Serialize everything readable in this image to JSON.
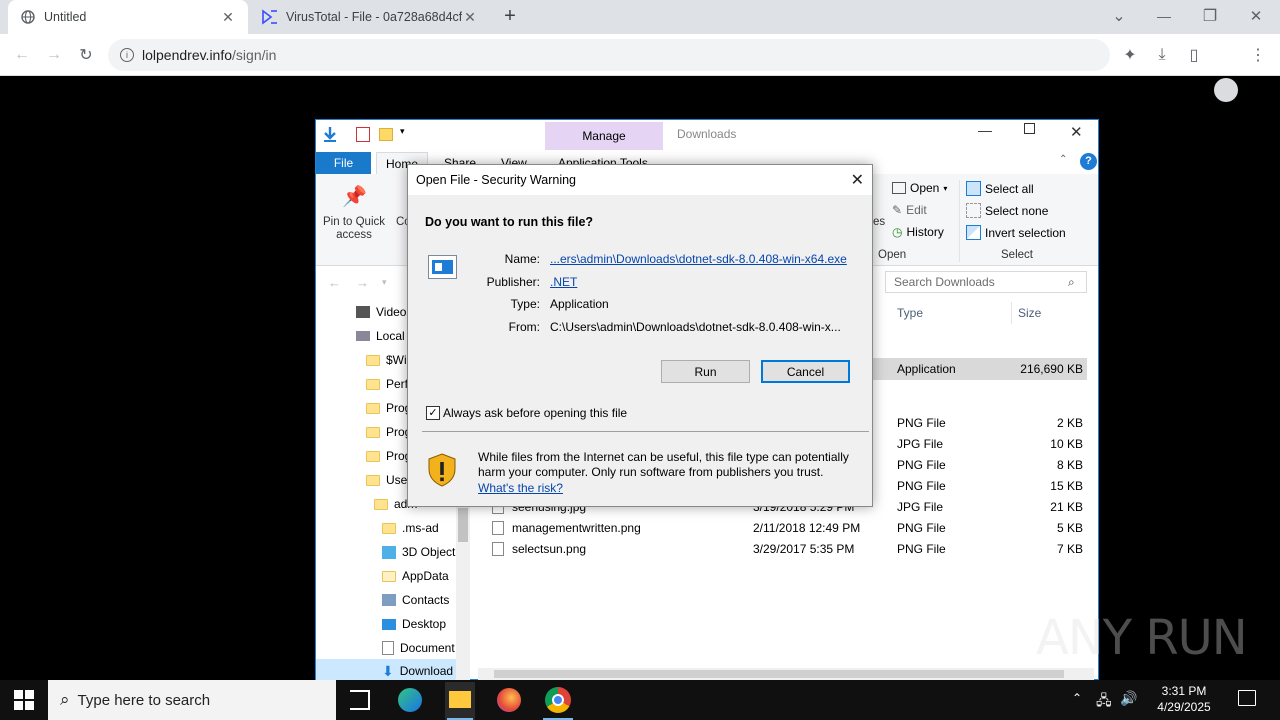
{
  "browser": {
    "tabs": [
      {
        "title": "Untitled",
        "close": "✕"
      },
      {
        "title": "VirusTotal - File - 0a728a68d4cf7…",
        "close": "✕"
      }
    ],
    "new_tab": "+",
    "url_host": "lolpendrev.info",
    "url_path": "/sign/in"
  },
  "explorer": {
    "manage_tab": "Manage",
    "window_title": "Downloads",
    "ribbon_tabs": [
      "File",
      "Home",
      "Share",
      "View",
      "Application Tools"
    ],
    "pin_label": "Pin to Quick access",
    "copy_label": "Co",
    "partial_label": "es",
    "open_group": {
      "open": "Open",
      "edit": "Edit",
      "history": "History",
      "label": "Open"
    },
    "select_group": {
      "select_all": "Select all",
      "select_none": "Select none",
      "invert": "Invert selection",
      "label": "Select"
    },
    "search_placeholder": "Search Downloads",
    "columns": {
      "type": "Type",
      "size": "Size"
    },
    "nav_items": [
      "Videos",
      "Local",
      "$Wi",
      "Perfl",
      "Prog",
      "Prog",
      "Prog",
      "User",
      "adm",
      ".ms-ad",
      "3D Object",
      "AppData",
      "Contacts",
      "Desktop",
      "Document",
      "Download"
    ],
    "selected_row": {
      "type": "Application",
      "size": "216,690 KB"
    },
    "files": [
      {
        "name": "",
        "date": "",
        "type": "PNG File",
        "size": "2 KB"
      },
      {
        "name": "",
        "date": "",
        "type": "JPG File",
        "size": "10 KB"
      },
      {
        "name": "",
        "date": "",
        "type": "PNG File",
        "size": "8 KB"
      },
      {
        "name": "",
        "date": "",
        "type": "PNG File",
        "size": "15 KB"
      },
      {
        "name": "seenusing.jpg",
        "date": "3/19/2018 5:29 PM",
        "type": "JPG File",
        "size": "21 KB"
      },
      {
        "name": "managementwritten.png",
        "date": "2/11/2018 12:49 PM",
        "type": "PNG File",
        "size": "5 KB"
      },
      {
        "name": "selectsun.png",
        "date": "3/29/2017 5:35 PM",
        "type": "PNG File",
        "size": "7 KB"
      }
    ]
  },
  "dialog": {
    "title": "Open File - Security Warning",
    "question": "Do you want to run this file?",
    "name_label": "Name:",
    "name_value": "...ers\\admin\\Downloads\\dotnet-sdk-8.0.408-win-x64.exe",
    "publisher_label": "Publisher:",
    "publisher_value": ".NET",
    "type_label": "Type:",
    "type_value": "Application",
    "from_label": "From:",
    "from_value": "C:\\Users\\admin\\Downloads\\dotnet-sdk-8.0.408-win-x...",
    "run_button": "Run",
    "cancel_button": "Cancel",
    "checkbox_label": "Always ask before opening this file",
    "checkbox_checked": true,
    "warning_text": "While files from the Internet can be useful, this file type can potentially harm your computer. Only run software from publishers you trust.",
    "risk_link": "What's the risk?"
  },
  "taskbar": {
    "search_placeholder": "Type here to search",
    "time": "3:31 PM",
    "date": "4/29/2025"
  },
  "watermark": "ANY RUN",
  "colors": {
    "chrome_tabstrip": "#dee1e6",
    "explorer_file_tab": "#1979ca",
    "manage_tab": "#e6d4f5",
    "taskbar": "#101010",
    "link": "#0645ad"
  }
}
